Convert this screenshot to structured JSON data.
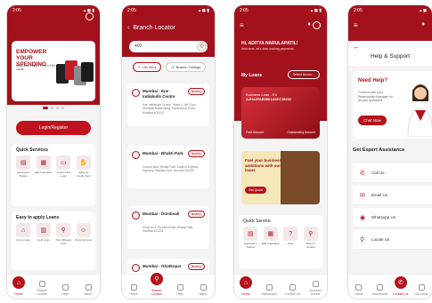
{
  "colors": {
    "brand_red": "#b5121b",
    "background": "#f4f4f4"
  },
  "screens": {
    "home": {
      "status_time": "2:05",
      "banner": {
        "title": "EMPOWER YOUR SPENDING",
        "subtitle": "Shop with Bajaj Finserv EMI cards"
      },
      "login_button": "Login/Register",
      "quick_services": {
        "title": "Quick Services",
        "items": [
          "Application Tracker",
          "EMI Calculator",
          "Credit Card Login",
          "Apply for Credit Card"
        ]
      },
      "loans": {
        "title": "Easy to apply Loans",
        "items": [
          "Home Loan",
          "Gold Loan",
          "Two Wheeler Loan",
          "Personal Loan"
        ]
      },
      "nav": [
        "Home",
        "Branch Locator",
        "Help",
        "Menu"
      ]
    },
    "branch_locator": {
      "status_time": "2:05",
      "title": "Branch Locator",
      "search_value": "400",
      "filters": [
        "List View",
        "Branch Timings"
      ],
      "branches": [
        {
          "name": "Mumbai - Ene Indiabulls Centre",
          "badge": "Nearby",
          "address": "Ene Indiabulls Centre, Tower 1, 9th Floor, Senapati Bapat Marg, Elphinstone Road, Mumbai 400013"
        },
        {
          "name": "Mumbai - Bhakti Park",
          "badge": "Nearby",
          "address": "Ground floor, Bhakti Park, Eastern Express Highway, Wadala East, Mumbai 400037"
        },
        {
          "name": "Mumbai - Dombvali",
          "badge": "Nearby",
          "address": "Shop no 4, Dombivli East, Shivaji Path, Mumbai 421201"
        },
        {
          "name": "Mumbai - Ghatkopar",
          "badge": "Nearby",
          "address": ""
        }
      ],
      "nav": [
        "Home",
        "Branch Locator",
        "Help",
        "Menu"
      ]
    },
    "dashboard": {
      "status_time": "2:05",
      "greeting": "Hi, ADITYA NARULAPATIL!",
      "greeting_sub": "Welcome, let's start making payments",
      "my_loans": "My Loans",
      "loan_select": "Select Accou...",
      "loan_card": {
        "type": "Business Loan - EV",
        "number": "AJH4JPAB0001A0DT25252",
        "label_left": "Paid Amount",
        "label_right": "Outstanding Amount"
      },
      "promo": {
        "title": "Fuel your business ambitions with our loans",
        "button": "Get Quote"
      },
      "quick_service_title": "Quick Service",
      "quick_items": [
        "Application Tracker",
        "EMI Calculator",
        "Help",
        "Branch Locator"
      ],
      "nav": [
        "Home",
        "Dashboard",
        "Contact Us",
        "Account Details"
      ]
    },
    "help": {
      "status_time": "2:05",
      "title": "Help & Support",
      "need_help": "Need Help?",
      "need_help_sub": "Connect with your Relationship Manager for all your questions",
      "chat_button": "Chat Now",
      "expert_title": "Get Expert Assistance",
      "options": [
        {
          "label": "Call Us",
          "icon": "phone-icon"
        },
        {
          "label": "Email Us",
          "icon": "mail-icon"
        },
        {
          "label": "Whatsapp Us",
          "icon": "whatsapp-icon"
        },
        {
          "label": "Locate Us",
          "icon": "location-icon"
        }
      ],
      "nav": [
        "Home",
        "Dashboard",
        "Contact Us",
        "Accounts"
      ]
    }
  }
}
